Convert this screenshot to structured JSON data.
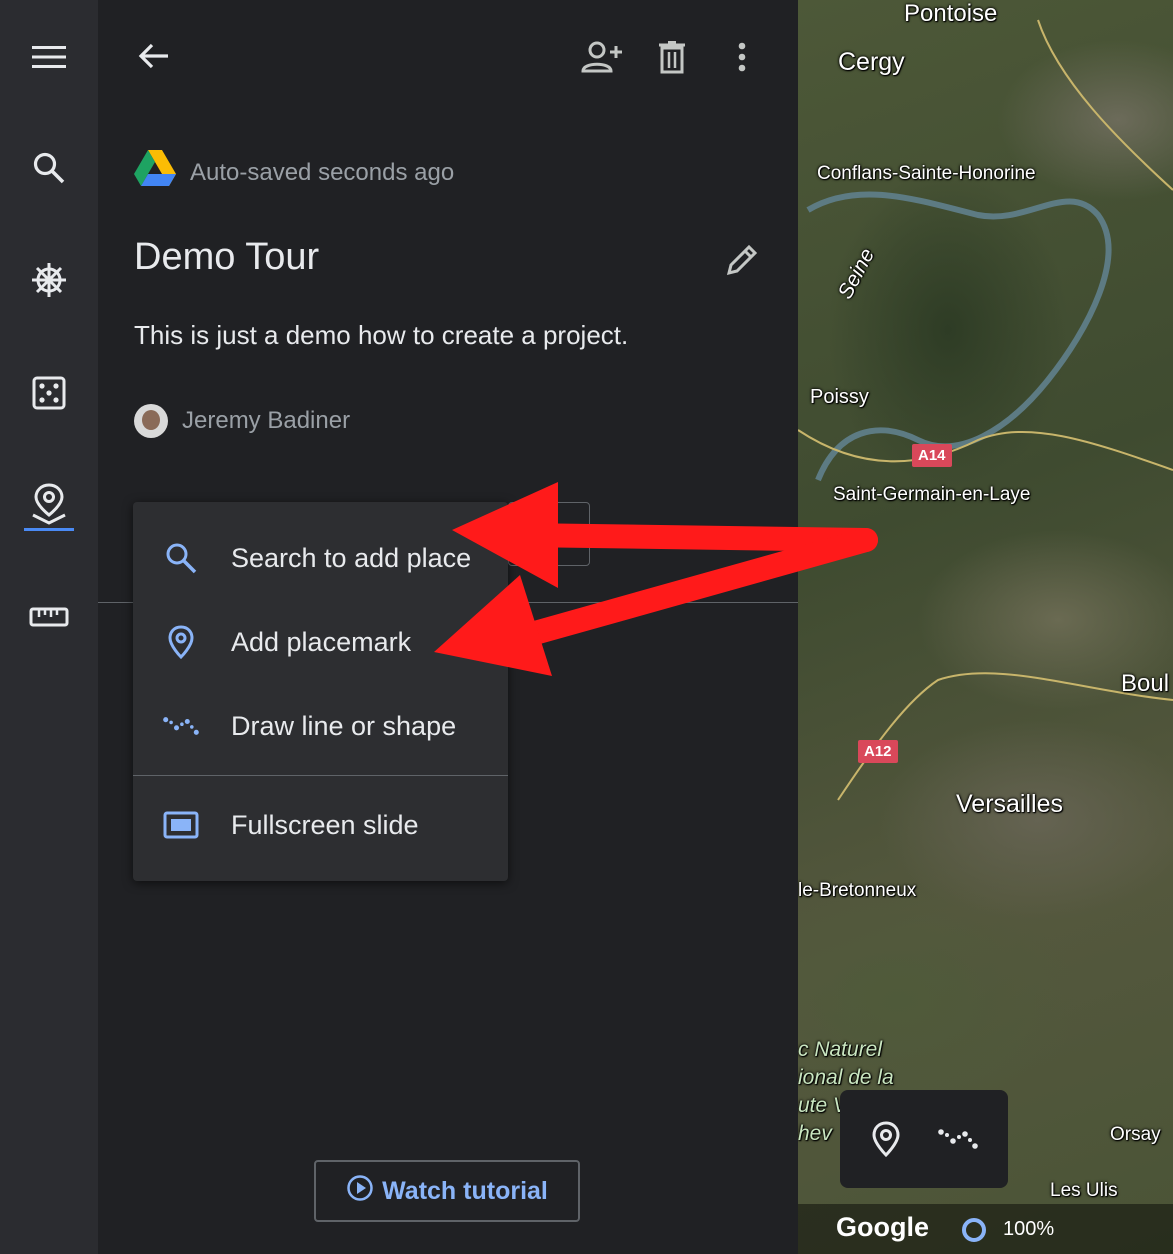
{
  "header": {
    "autosave_text": "Auto-saved seconds ago"
  },
  "project": {
    "title": "Demo Tour",
    "description": "This is just a demo how to create a project.",
    "author": "Jeremy Badiner"
  },
  "add_menu": {
    "items": [
      {
        "label": "Search to add place",
        "icon": "search-icon"
      },
      {
        "label": "Add placemark",
        "icon": "placemark-icon"
      },
      {
        "label": "Draw line or shape",
        "icon": "polyline-icon"
      },
      {
        "label": "Fullscreen slide",
        "icon": "slide-icon"
      }
    ]
  },
  "footer": {
    "tutorial_label": "Watch tutorial"
  },
  "map": {
    "labels": {
      "pontoise": "Pontoise",
      "cergy": "Cergy",
      "conflans": "Conflans-Sainte-Honorine",
      "seine": "Seine",
      "poissy": "Poissy",
      "saint_germain": "Saint-Germain-en-Laye",
      "boul": "Boul",
      "versailles": "Versailles",
      "bretonneux": "le-Bretonneux",
      "parc1": "c Naturel",
      "parc2": "ional de la",
      "parc3": "ute V",
      "parc4": "hev",
      "orsay": "Orsay",
      "les_ulis": "Les Ulis"
    },
    "roads": {
      "a14": "A14",
      "a12": "A12"
    },
    "attribution": "Google",
    "zoom": "100%"
  },
  "colors": {
    "accent": "#4a8af4",
    "link": "#8ab4f8",
    "annotation_arrow": "#ff1a1a"
  }
}
